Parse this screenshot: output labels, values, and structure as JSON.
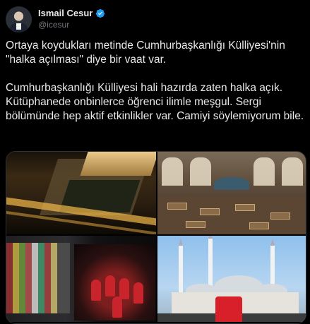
{
  "author": {
    "name": "Ismail Cesur",
    "handle": "@icesur",
    "verified": true,
    "verified_color": "#1d9bf0"
  },
  "tweet": {
    "text": "Ortaya koydukları metinde Cumhurbaşkanlığı Külliyesi'nin \"halka açılması\" diye bir vaat var.\n\nCumhurbaşkanlığı Külliyesi hali hazırda zaten halka açık. Kütüphanede onbinlerce öğrenci ilimle meşgul. Sergi bölümünde hep aktif etkinlikler var. Camiyi söylemiyorum bile."
  },
  "media": [
    {
      "icon": "night-aerial-complex-photo"
    },
    {
      "icon": "library-interior-photo"
    },
    {
      "icon": "exhibition-photo"
    },
    {
      "icon": "mosque-photo"
    }
  ],
  "colors": {
    "background": "#000000",
    "text": "#e7e9ea",
    "muted": "#71767b"
  }
}
